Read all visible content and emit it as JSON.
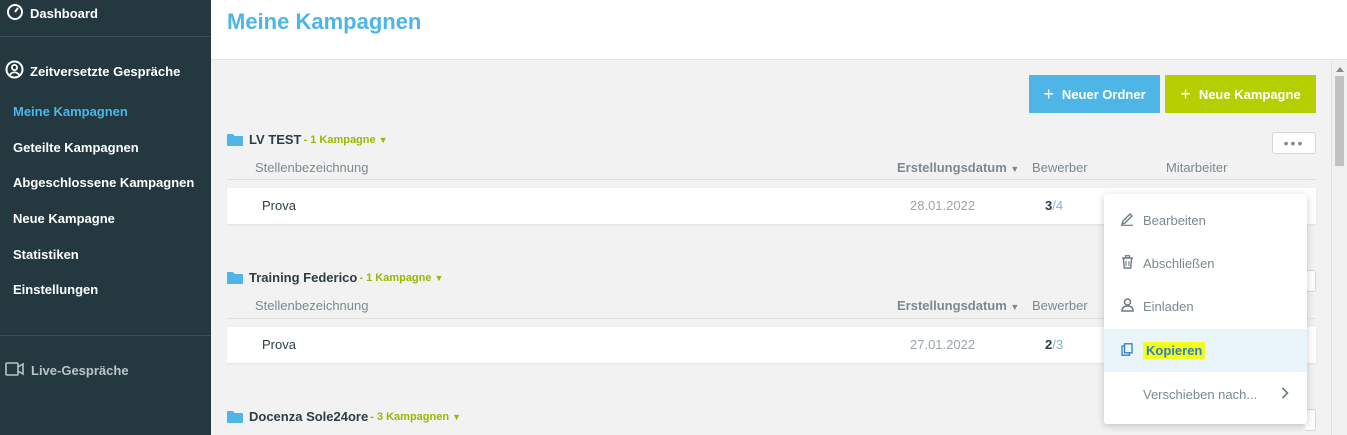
{
  "sidebar": {
    "dashboard": "Dashboard",
    "section": "Zeitversetzte Gespräche",
    "items": [
      {
        "label": "Meine Kampagnen",
        "active": true
      },
      {
        "label": "Geteilte Kampagnen"
      },
      {
        "label": "Abgeschlossene Kampagnen"
      },
      {
        "label": "Neue Kampagne"
      },
      {
        "label": "Statistiken"
      },
      {
        "label": "Einstellungen"
      }
    ],
    "live": "Live-Gespräche"
  },
  "header": {
    "title": "Meine Kampagnen"
  },
  "toolbar": {
    "new_folder": "Neuer Ordner",
    "new_campaign": "Neue Kampagne"
  },
  "columns": {
    "title": "Stellenbezeichnung",
    "date": "Erstellungsdatum",
    "applicants": "Bewerber",
    "staff": "Mitarbeiter"
  },
  "folders": [
    {
      "name": "LV TEST",
      "count": "- 1 Kampagne",
      "rows": [
        {
          "name": "Prova",
          "date": "28.01.2022",
          "done": "3",
          "total": "/4"
        }
      ]
    },
    {
      "name": "Training Federico",
      "count": "- 1 Kampagne",
      "rows": [
        {
          "name": "Prova",
          "date": "27.01.2022",
          "done": "2",
          "total": "/3"
        }
      ]
    },
    {
      "name": "Docenza Sole24ore",
      "count": "- 3 Kampagnen",
      "rows": []
    }
  ],
  "menu": {
    "edit": "Bearbeiten",
    "close": "Abschließen",
    "invite": "Einladen",
    "copy": "Kopieren",
    "move": "Verschieben nach..."
  },
  "colors": {
    "accent": "#4db6e6",
    "lime": "#b6cf00",
    "sidebar": "#23383f",
    "highlight": "#f3ff1a"
  }
}
